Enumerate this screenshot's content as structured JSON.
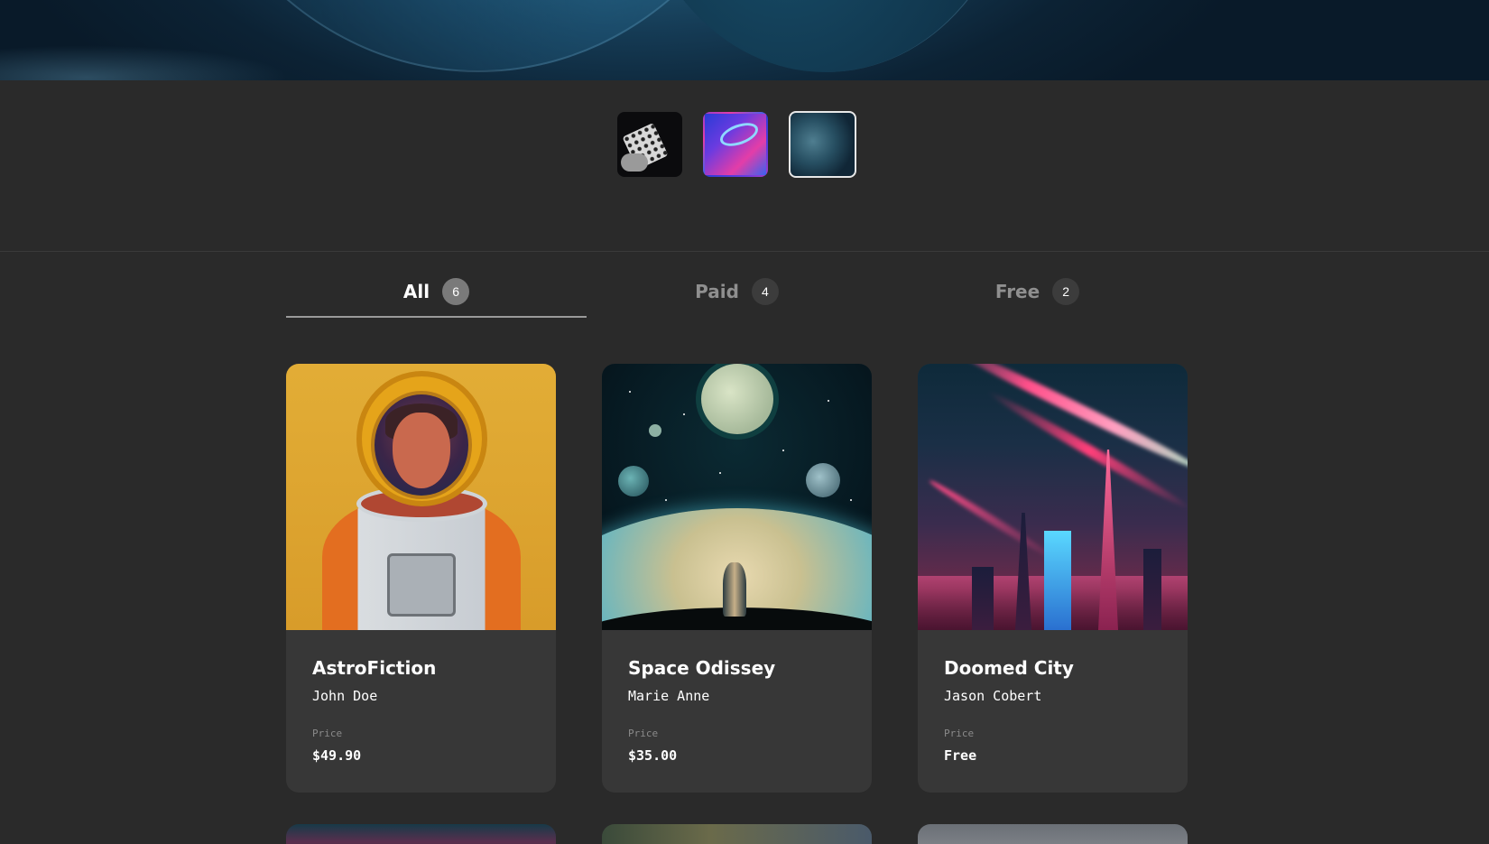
{
  "gallery": {
    "avatars": [
      {
        "icon": "nft-thumbnail-dice-hand"
      },
      {
        "icon": "nft-thumbnail-neon-ring"
      },
      {
        "icon": "nft-thumbnail-planet",
        "selected": true
      }
    ]
  },
  "tabs": [
    {
      "label": "All",
      "count": "6",
      "active": true
    },
    {
      "label": "Paid",
      "count": "4",
      "active": false
    },
    {
      "label": "Free",
      "count": "2",
      "active": false
    }
  ],
  "cards": [
    {
      "title": "AstroFiction",
      "author": "John Doe",
      "price_label": "Price",
      "price": "$49.90"
    },
    {
      "title": "Space Odissey",
      "author": "Marie Anne",
      "price_label": "Price",
      "price": "$35.00"
    },
    {
      "title": "Doomed City",
      "author": "Jason Cobert",
      "price_label": "Price",
      "price": "Free"
    }
  ],
  "colors": {
    "background": "#2a2a2a",
    "card": "#373737",
    "active_tab_underline": "#9a9a9a"
  }
}
